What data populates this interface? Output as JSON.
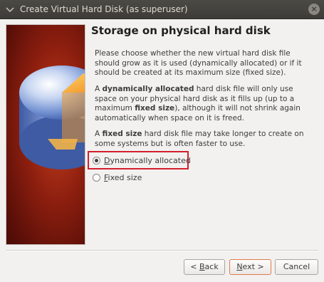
{
  "window": {
    "title": "Create Virtual Hard Disk (as superuser)",
    "close_glyph": "×"
  },
  "page": {
    "title": "Storage on physical hard disk",
    "intro": "Please choose whether the new virtual hard disk file should grow as it is used (dynamically allocated) or if it should be created at its maximum size (fixed size).",
    "dynamic_desc": {
      "a": "A ",
      "b": "dynamically allocated",
      "c": " hard disk file will only use space on your physical hard disk as it fills up (up to a maximum ",
      "d": "fixed size",
      "e": "), although it will not shrink again automatically when space on it is freed."
    },
    "fixed_desc": {
      "a": "A ",
      "b": "fixed size",
      "c": " hard disk file may take longer to create on some systems but is often faster to use."
    }
  },
  "options": {
    "dynamic": {
      "label_accel": "D",
      "label_rest": "ynamically allocated",
      "checked": true
    },
    "fixed": {
      "label_accel": "F",
      "label_rest": "ixed size",
      "checked": false
    }
  },
  "buttons": {
    "back": {
      "pre": "< ",
      "accel": "B",
      "rest": "ack"
    },
    "next": {
      "pre": "",
      "accel": "N",
      "rest": "ext >"
    },
    "cancel": {
      "label": "Cancel"
    }
  },
  "colors": {
    "highlight": "#d41f2e",
    "watermark_bg": "#8e1f0f",
    "titlebar": "#3d3c38"
  },
  "icons": {
    "watermark": "hard-disk-pie-icon",
    "menu": "window-menu-icon",
    "close": "close-icon"
  }
}
